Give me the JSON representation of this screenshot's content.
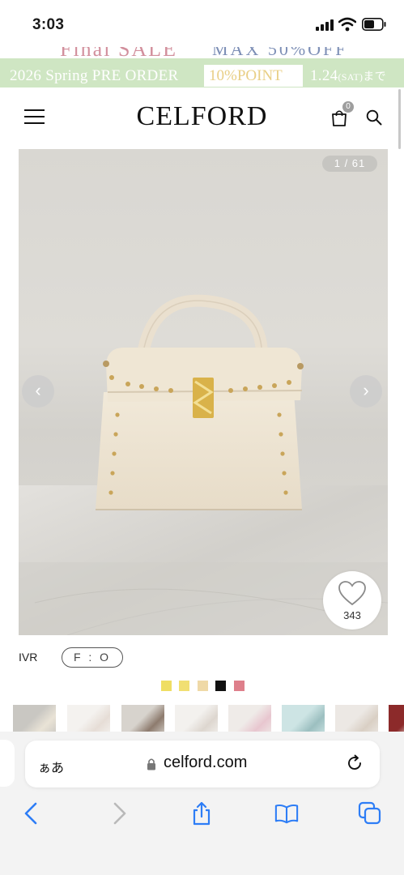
{
  "status_bar": {
    "time": "3:03"
  },
  "sale_banner": {
    "text": "Final SALE",
    "max_text": "MAX 50%OFF"
  },
  "order_banner": {
    "title": "2026 Spring PRE ORDER",
    "point": "10%POINT",
    "date": "1.24",
    "date_small": "(SAT)",
    "until": "まで"
  },
  "header": {
    "logo": "CELFORD",
    "cart_count": "0"
  },
  "gallery": {
    "counter": "1 / 61",
    "prev": "‹",
    "next": "›",
    "likes": "343"
  },
  "product": {
    "color_code": "IVR",
    "size": "F : O",
    "swatches": [
      "#efde63",
      "#f1df72",
      "#efd9a7",
      "#111111",
      "#de7f8b"
    ]
  },
  "colors": {
    "banner_green": "#cfe6c3",
    "point_gold": "#e9cf86",
    "accent_blue": "#1a73e8"
  },
  "thumbnails": [
    {
      "bg": "#c9c7c2",
      "fg": "#e9e3d6"
    },
    {
      "bg": "#f4f2ef",
      "fg": "#e6ddd6"
    },
    {
      "bg": "#d7d3cd",
      "fg": "#8d7b6e"
    },
    {
      "bg": "#f3f1ee",
      "fg": "#ddd6cf"
    },
    {
      "bg": "#efebe8",
      "fg": "#e8c6cf"
    },
    {
      "bg": "#cde4e4",
      "fg": "#9cbfc0"
    },
    {
      "bg": "#ece8e4",
      "fg": "#d9cfc4"
    },
    {
      "bg": "#8c2a2a",
      "fg": "#e8e2db"
    }
  ],
  "browser": {
    "aa_label": "ぁあ",
    "url": "celford.com"
  },
  "toolbar": {
    "icons": [
      "back-icon",
      "forward-icon",
      "share-icon",
      "bookmarks-icon",
      "tabs-icon"
    ]
  }
}
